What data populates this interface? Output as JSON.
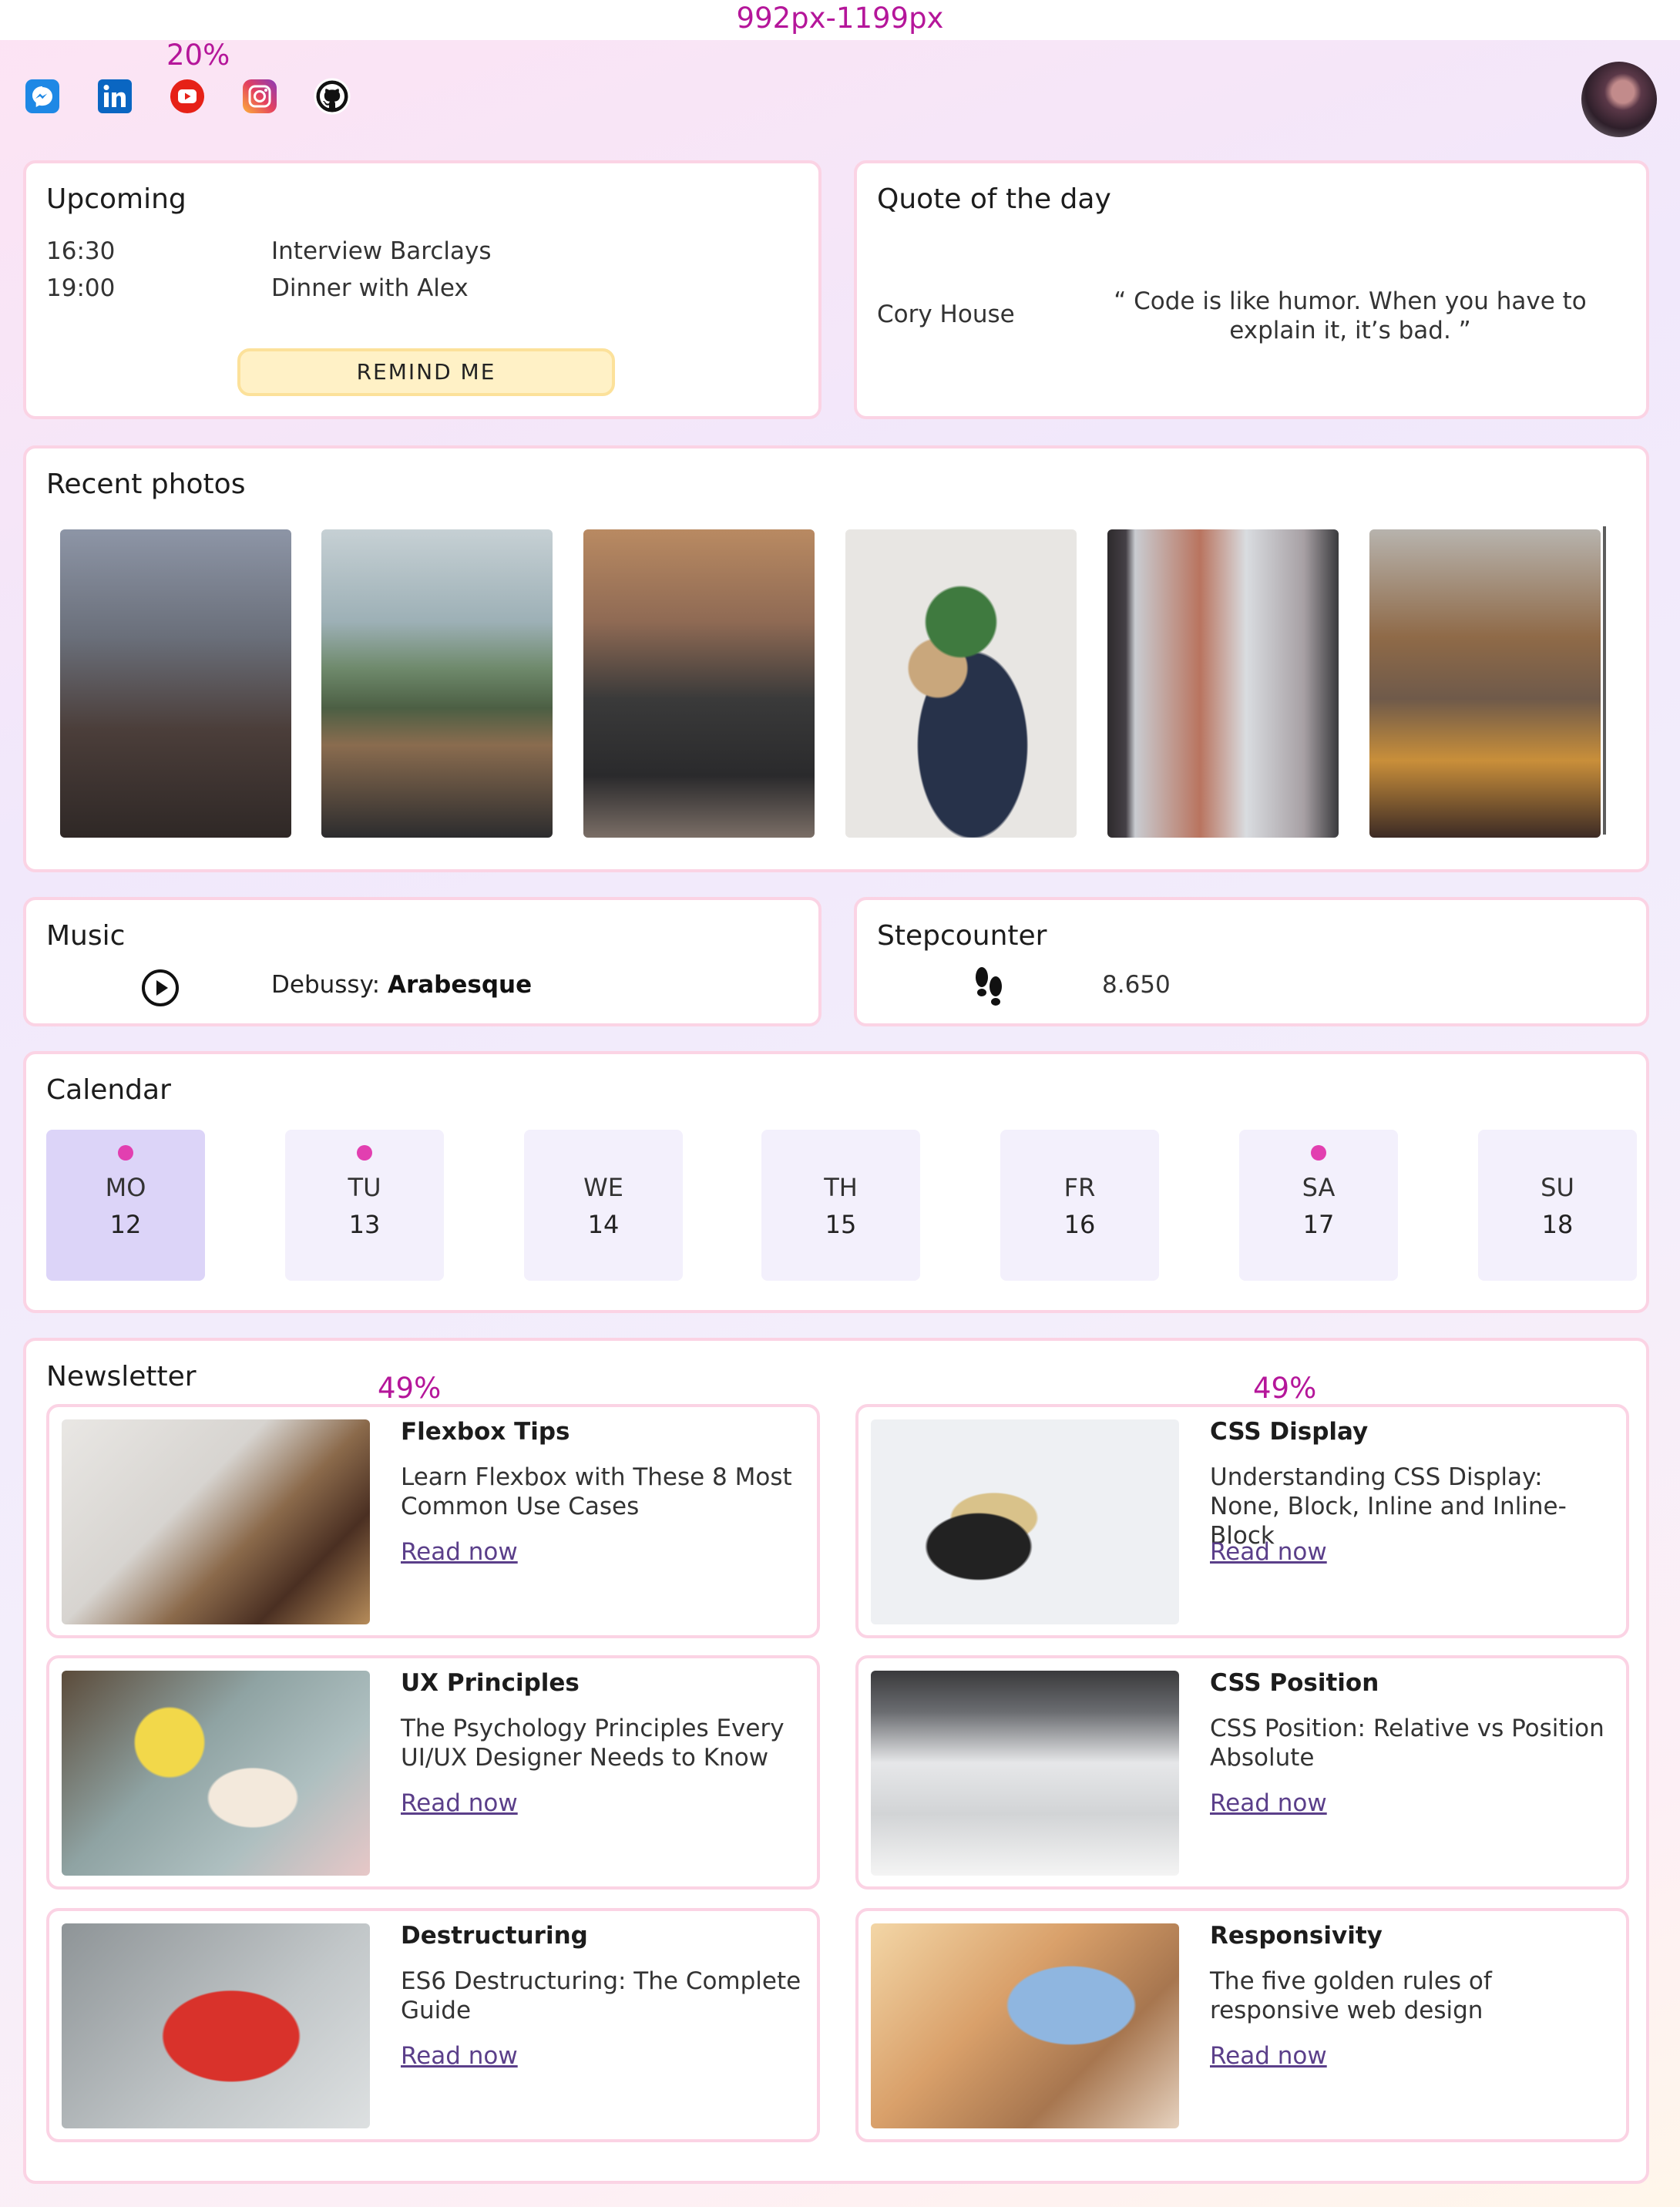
{
  "viewport_label": "992px-1199px",
  "header_percent": "20%",
  "socials": [
    {
      "icon": "messenger-icon",
      "color": "#1e88e5"
    },
    {
      "icon": "linkedin-icon",
      "color": "#0a66c2"
    },
    {
      "icon": "youtube-icon",
      "color": "#e62117"
    },
    {
      "icon": "instagram-icon",
      "color": "#e4405f"
    },
    {
      "icon": "github-icon",
      "color": "#111111"
    }
  ],
  "upcoming": {
    "title": "Upcoming",
    "events": [
      {
        "time": "16:30",
        "label": "Interview Barclays"
      },
      {
        "time": "19:00",
        "label": "Dinner with Alex"
      }
    ],
    "button": "REMIND ME"
  },
  "quote": {
    "title": "Quote of the day",
    "author": "Cory House",
    "text": "“ Code is like humor. When you have to explain it, it’s bad. ”"
  },
  "photos": {
    "title": "Recent photos"
  },
  "music": {
    "title": "Music",
    "composer": "Debussy: ",
    "piece": "Arabesque"
  },
  "steps": {
    "title": "Stepcounter",
    "count": "8.650"
  },
  "calendar": {
    "title": "Calendar",
    "days": [
      {
        "name": "MO",
        "num": "12",
        "dot": true,
        "active": true
      },
      {
        "name": "TU",
        "num": "13",
        "dot": true,
        "active": false
      },
      {
        "name": "WE",
        "num": "14",
        "dot": false,
        "active": false
      },
      {
        "name": "TH",
        "num": "15",
        "dot": false,
        "active": false
      },
      {
        "name": "FR",
        "num": "16",
        "dot": false,
        "active": false
      },
      {
        "name": "SA",
        "num": "17",
        "dot": true,
        "active": false
      },
      {
        "name": "SU",
        "num": "18",
        "dot": false,
        "active": false
      }
    ]
  },
  "newsletter": {
    "title": "Newsletter",
    "col_percent_left": "49%",
    "col_percent_right": "49%",
    "articles": [
      {
        "title": "Flexbox Tips",
        "desc": "Learn Flexbox with These 8 Most Common Use Cases",
        "link": "Read now"
      },
      {
        "title": "CSS Display",
        "desc": "Understanding CSS Display: None, Block, Inline and Inline-Block",
        "link": "Read now"
      },
      {
        "title": "UX Principles",
        "desc": "The Psychology Principles Every UI/UX Designer Needs to Know",
        "link": "Read now"
      },
      {
        "title": "CSS Position",
        "desc": "CSS Position: Relative vs Position Absolute",
        "link": "Read now"
      },
      {
        "title": "Destructuring",
        "desc": "ES6 Destructuring: The Complete Guide",
        "link": "Read now"
      },
      {
        "title": "Responsivity",
        "desc": "The five golden rules of responsive web design",
        "link": "Read now"
      }
    ]
  }
}
